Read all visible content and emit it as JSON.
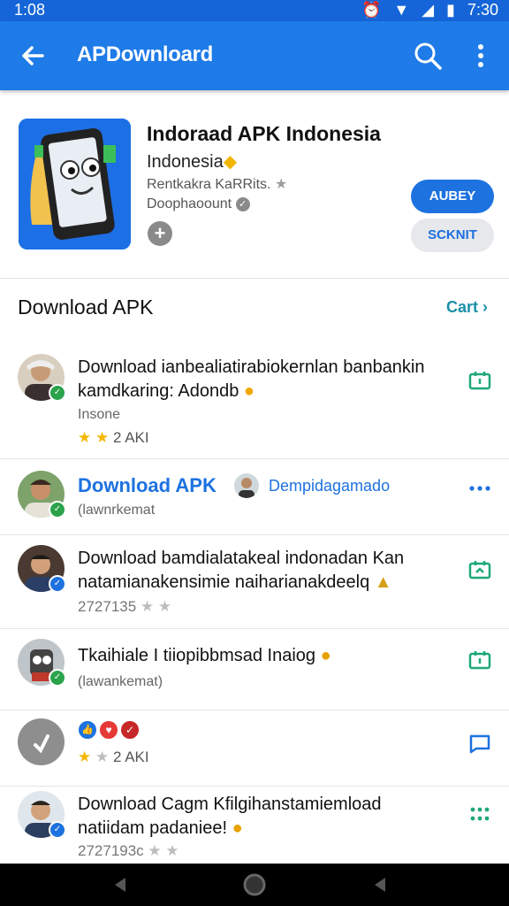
{
  "status": {
    "time": "1:08",
    "clock": "7:30"
  },
  "appbar": {
    "title": "APDownloard"
  },
  "app": {
    "title": "Indoraad APK Indonesia",
    "subtitle": "Indonesia",
    "developer": "Rentkakra KaRRits.",
    "downloads": "Doophaoount",
    "primary_button": "AUBEY",
    "secondary_button": "SCKNIT"
  },
  "section": {
    "title": "Download APK",
    "link": "Cart"
  },
  "items": [
    {
      "line1": "Download ianbealiatirabiokernlan banbankin",
      "line2": "kamdkaring: Adondb",
      "small": "Insone",
      "rating": "2 AKI"
    },
    {
      "title": "Download APK",
      "mention": "Dempidagamado",
      "small": "(lawnrkemat"
    },
    {
      "line1": "Download bamdialatakeal indonadan Kan",
      "line2": "natamianakensimie naiharianakdeelq",
      "small": "2727135"
    },
    {
      "line1": "Tkaihiale I tiiopibbmsad Inaiog",
      "small": "(lawankemat)"
    },
    {
      "rating": "2 AKI"
    },
    {
      "line1": "Download Cagm Kfilgihanstamiemload",
      "line2": "natiidam padaniee!",
      "small": "2727193c"
    }
  ],
  "colors": {
    "appbar": "#1e7be8",
    "status": "#1565d8",
    "accent_green": "#1fa87a",
    "accent_blue": "#1d72e0"
  },
  "icons": [
    "back-arrow-icon",
    "search-icon",
    "more-vert-icon",
    "battery-icon",
    "wifi-icon",
    "signal-icon"
  ]
}
